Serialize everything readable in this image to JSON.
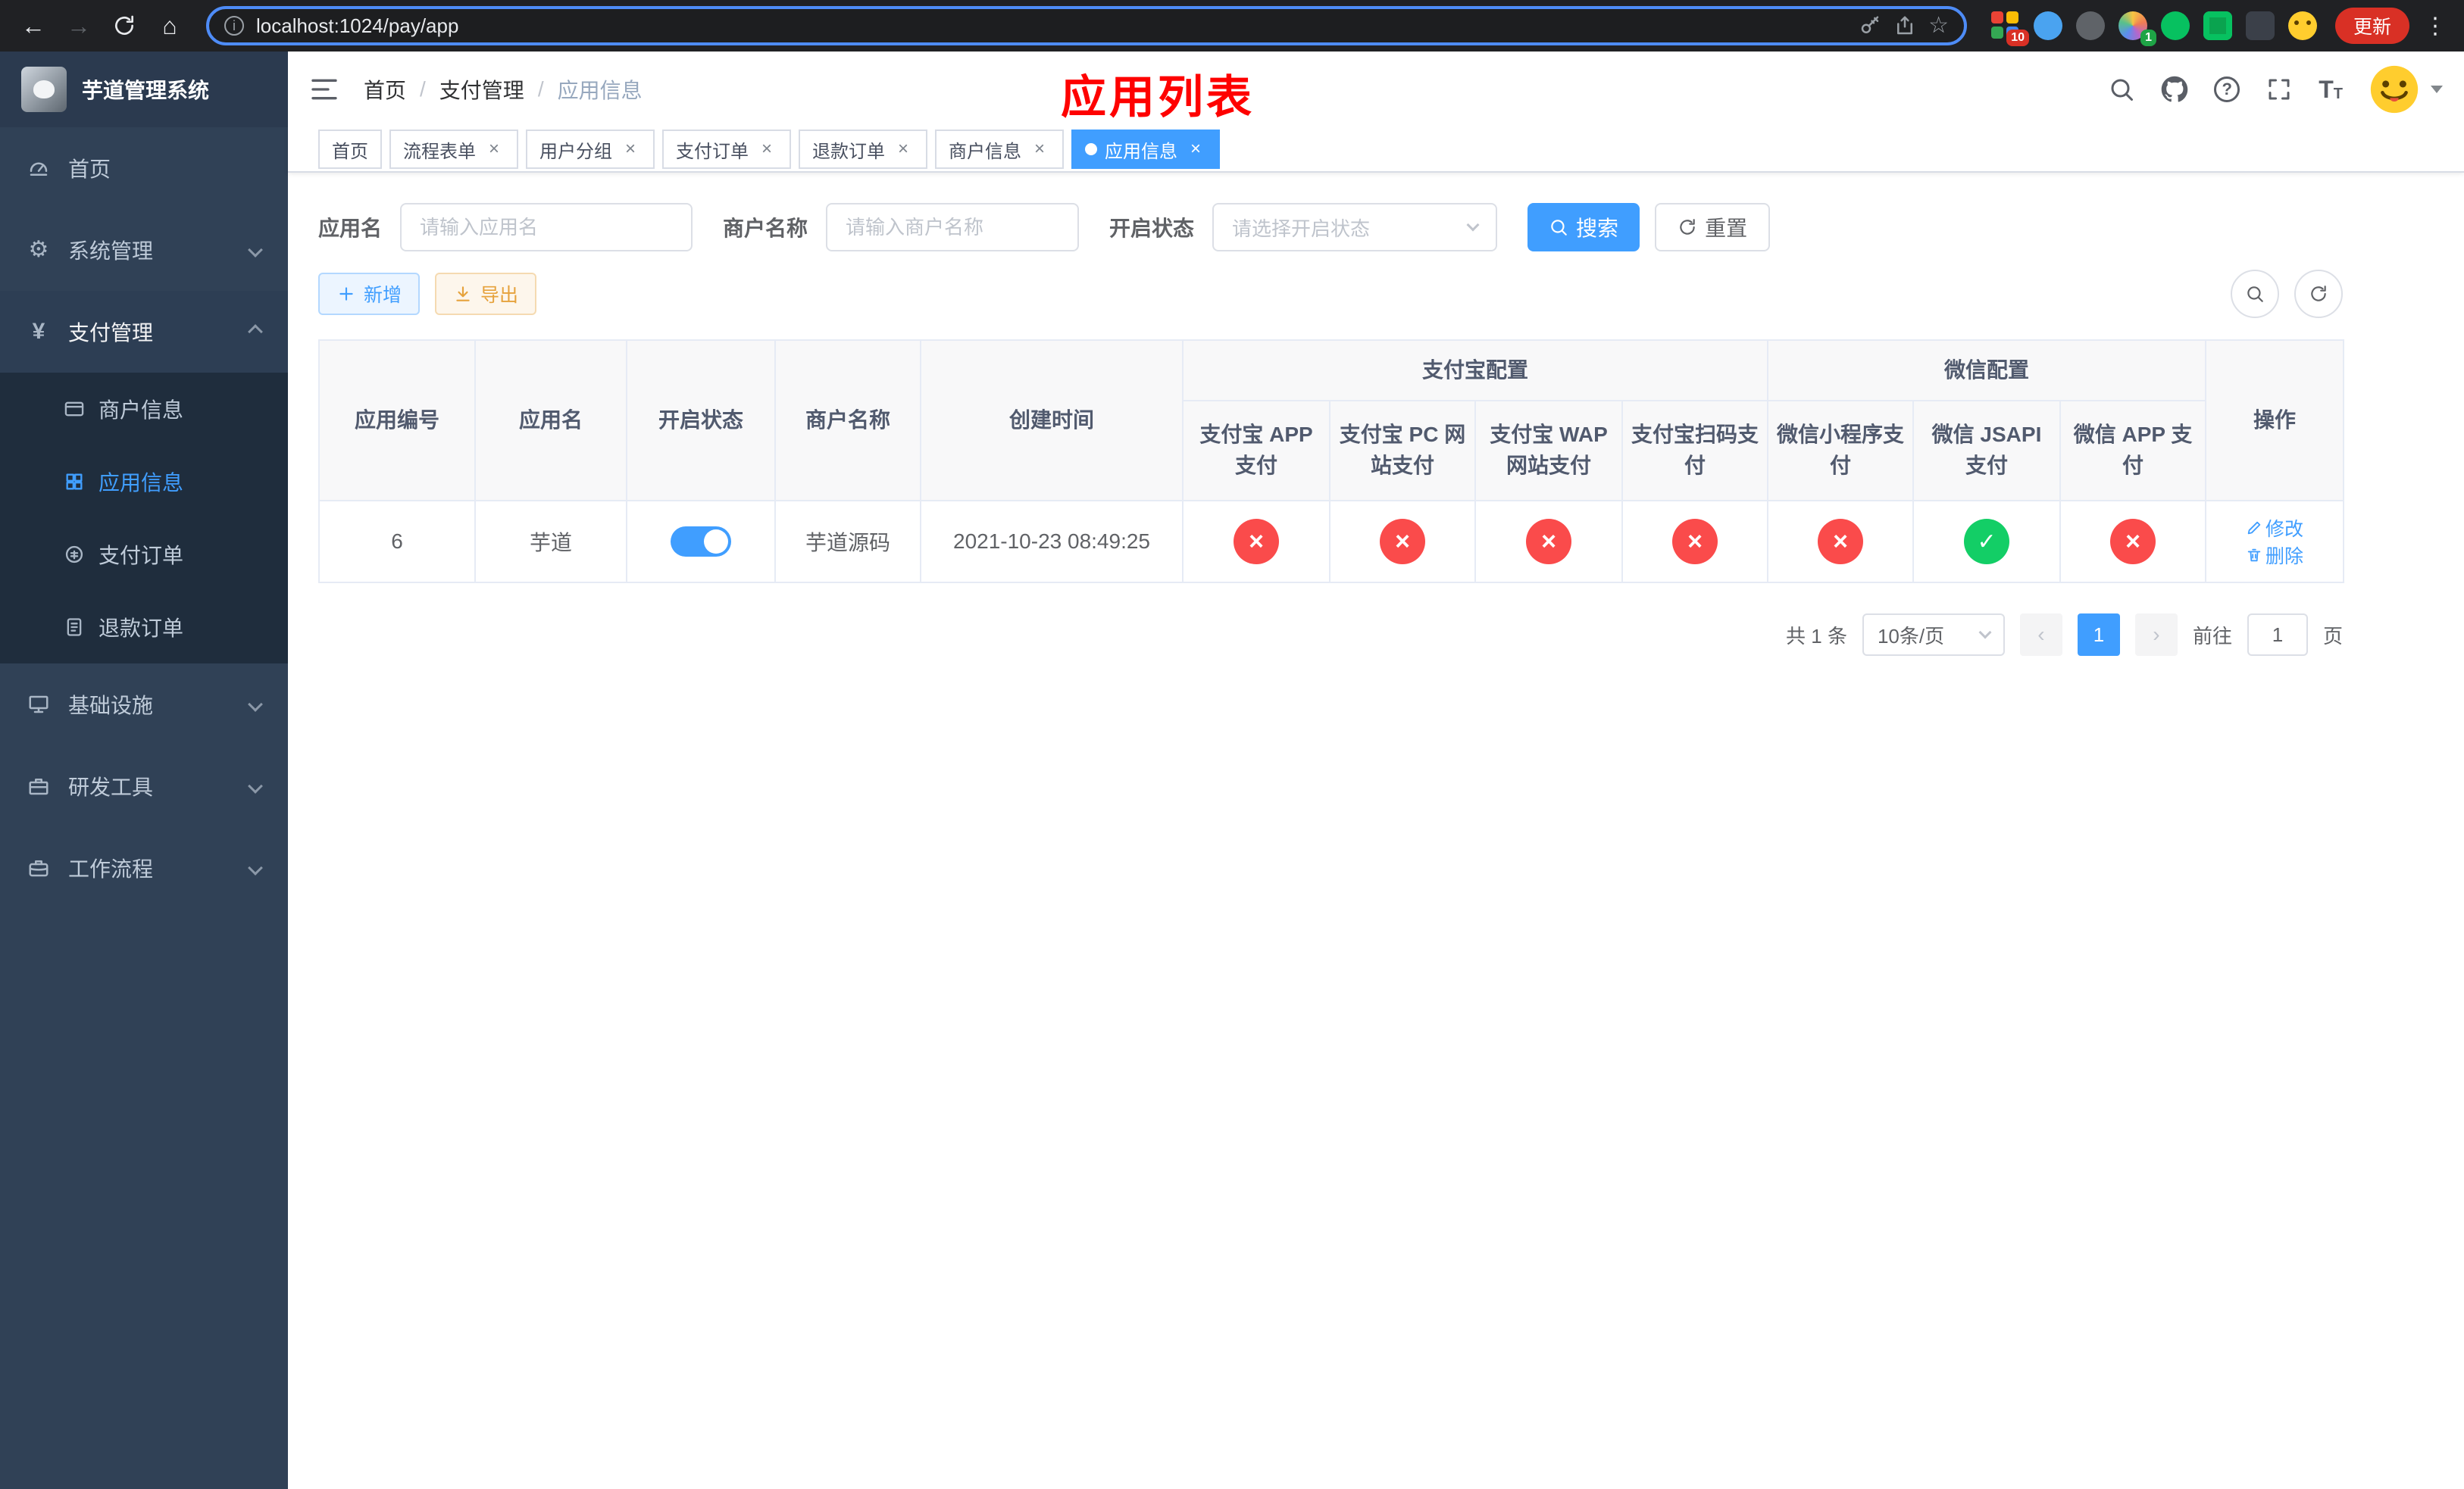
{
  "colors": {
    "accent": "#409EFF",
    "success": "#13ce66",
    "danger": "#fa4b4b"
  },
  "icons": {
    "check": "✓",
    "cross": "×",
    "close": "×",
    "gear": "⚙",
    "yen": "¥",
    "star": "☆",
    "back": "←",
    "forward": "→",
    "home": "⌂",
    "kebab": "⋮",
    "prev": "‹",
    "next": "›",
    "info": "i",
    "question": "?",
    "font_size": "T"
  },
  "browser": {
    "url": "localhost:1024/pay/app",
    "update_button": "更新",
    "extension_badges": {
      "grid": "10",
      "rainbow": "1"
    }
  },
  "sidebar": {
    "title": "芋道管理系统",
    "items": [
      {
        "label": "首页"
      },
      {
        "label": "系统管理"
      },
      {
        "label": "支付管理",
        "expanded": true,
        "children": [
          {
            "label": "商户信息"
          },
          {
            "label": "应用信息",
            "active": true
          },
          {
            "label": "支付订单"
          },
          {
            "label": "退款订单"
          }
        ]
      },
      {
        "label": "基础设施"
      },
      {
        "label": "研发工具"
      },
      {
        "label": "工作流程"
      }
    ]
  },
  "navbar": {
    "breadcrumb": [
      "首页",
      "支付管理",
      "应用信息"
    ],
    "separator": "/",
    "annotation": "应用列表"
  },
  "tabs": [
    {
      "label": "首页",
      "closable": false
    },
    {
      "label": "流程表单",
      "closable": true
    },
    {
      "label": "用户分组",
      "closable": true
    },
    {
      "label": "支付订单",
      "closable": true
    },
    {
      "label": "退款订单",
      "closable": true
    },
    {
      "label": "商户信息",
      "closable": true
    },
    {
      "label": "应用信息",
      "closable": true,
      "active": true
    }
  ],
  "filters": {
    "app_name_label": "应用名",
    "app_name_placeholder": "请输入应用名",
    "merchant_label": "商户名称",
    "merchant_placeholder": "请输入商户名称",
    "status_label": "开启状态",
    "status_placeholder": "请选择开启状态",
    "search_button": "搜索",
    "reset_button": "重置"
  },
  "toolbar": {
    "add_button": "新增",
    "export_button": "导出"
  },
  "table": {
    "group_headers": {
      "alipay": "支付宝配置",
      "wechat": "微信配置"
    },
    "columns": [
      "应用编号",
      "应用名",
      "开启状态",
      "商户名称",
      "创建时间",
      "支付宝 APP 支付",
      "支付宝 PC 网站支付",
      "支付宝 WAP 网站支付",
      "支付宝扫码支付",
      "微信小程序支付",
      "微信 JSAPI 支付",
      "微信 APP 支付",
      "操作"
    ],
    "actions": {
      "edit": "修改",
      "delete": "删除"
    },
    "rows": [
      {
        "id": "6",
        "name": "芋道",
        "enabled": true,
        "merchant": "芋道源码",
        "created": "2021-10-23 08:49:25",
        "channels": [
          "no",
          "no",
          "no",
          "no",
          "no",
          "yes",
          "no"
        ]
      }
    ]
  },
  "pagination": {
    "total": "共 1 条",
    "page_size": "10条/页",
    "current_page": "1",
    "goto": "前往",
    "goto_value": "1",
    "unit": "页"
  }
}
